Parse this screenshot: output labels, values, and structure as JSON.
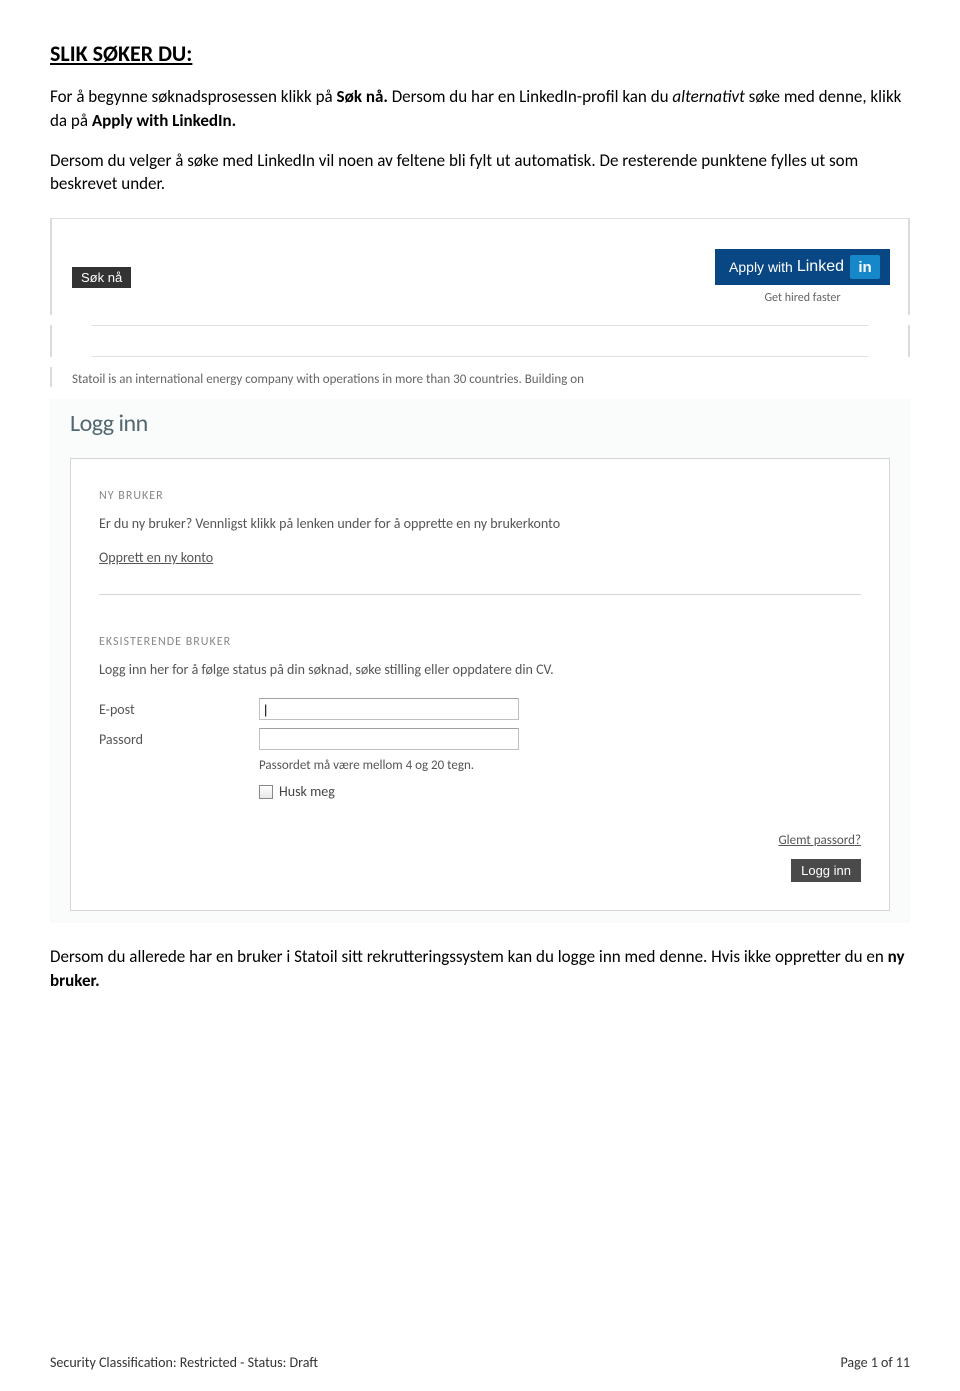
{
  "heading": "SLIK SØKER DU:",
  "para1_prefix": "For å begynne søknadsprosessen klikk på ",
  "para1_bold1": "Søk nå.",
  "para1_mid": " Dersom du har en LinkedIn-profil kan du ",
  "para1_italic": "alternativt",
  "para1_mid2": " søke med denne, klikk da på ",
  "para1_bold2": "Apply with LinkedIn.",
  "para2": "Dersom du velger å søke med LinkedIn vil noen av feltene bli fylt ut automatisk. De resterende punktene fylles ut som beskrevet under.",
  "screenshot1": {
    "sok_na": "Søk nå",
    "linkedin_btn_prefix": "Apply with",
    "linkedin_word": "Linked",
    "linkedin_icon": "in",
    "get_hired": "Get hired faster",
    "company_text": "Statoil is an international energy company with operations in more than 30 countries. Building on"
  },
  "login": {
    "title": "Logg inn",
    "ny_bruker_label": "NY BRUKER",
    "ny_bruker_desc": "Er du ny bruker? Vennligst klikk på lenken under for å opprette en ny brukerkonto",
    "opprett_link": "Opprett en ny konto",
    "eksisterende_label": "EKSISTERENDE BRUKER",
    "eksisterende_desc": "Logg inn her for å følge status på din søknad, søke stilling eller oppdatere din CV.",
    "email_label": "E-post",
    "email_value": "|",
    "password_label": "Passord",
    "password_hint": "Passordet må være mellom 4 og 20 tegn.",
    "husk_meg": "Husk meg",
    "glemt": "Glemt passord?",
    "login_btn": "Logg inn"
  },
  "para3_prefix": "Dersom du allerede har en bruker i Statoil sitt rekrutteringssystem kan du logge inn med denne. Hvis ikke oppretter du en ",
  "para3_bold": "ny bruker.",
  "footer": {
    "left": "Security Classification: Restricted - Status: Draft",
    "right": "Page 1 of 11"
  }
}
